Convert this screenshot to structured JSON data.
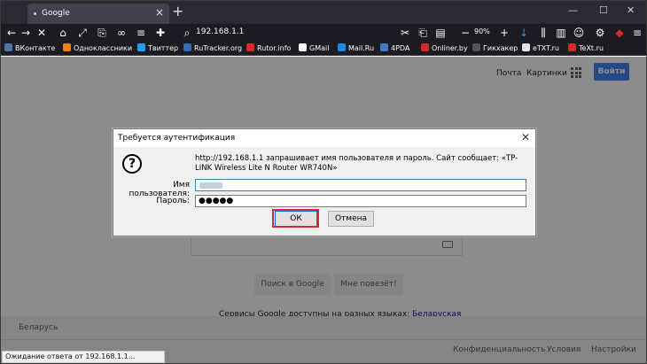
{
  "browser": {
    "tab_title": "Google",
    "url": "192.168.1.1",
    "zoom": "90%"
  },
  "bookmarks": [
    {
      "label": "ВКонтакте",
      "color": "#4a76a8"
    },
    {
      "label": "Одноклассники",
      "color": "#ee8208"
    },
    {
      "label": "Твиттер",
      "color": "#1da1f2"
    },
    {
      "label": "RuTracker.org",
      "color": "#2f6fb5"
    },
    {
      "label": "Rutor.info",
      "color": "#d9272e"
    },
    {
      "label": "GMail",
      "color": "#ffffff"
    },
    {
      "label": "Mail.Ru",
      "color": "#168de2"
    },
    {
      "label": "4PDA",
      "color": "#3b7cc4"
    },
    {
      "label": "Onliner.by",
      "color": "#d9272e"
    },
    {
      "label": "Гикхакер",
      "color": "#2b2b2b"
    },
    {
      "label": "eTXT.ru",
      "color": "#e4e4e4"
    },
    {
      "label": "TeXt.ru",
      "color": "#d9272e"
    }
  ],
  "google": {
    "link_mail": "Почта",
    "link_images": "Картинки",
    "signin_label": "Войти",
    "search_button": "Поиск в Google",
    "lucky_button": "Мне повезёт!",
    "offered_text": "Сервисы Google доступны на разных языках:",
    "offered_lang": "Беларуская",
    "region": "Беларусь",
    "footer_privacy": "Конфиденциальность",
    "footer_terms": "Условия",
    "footer_settings": "Настройки"
  },
  "status_text": "Ожидание ответа от 192.168.1.1...",
  "dialog": {
    "title": "Требуется аутентификация",
    "message": "http://192.168.1.1 запрашивает имя пользователя и пароль. Сайт сообщает: «TP-LINK Wireless Lite N Router WR740N»",
    "username_label": "Имя пользователя:",
    "password_label": "Пароль:",
    "password_value": "●●●●●",
    "ok_label": "ОК",
    "cancel_label": "Отмена"
  },
  "colors": {
    "highlight": "#d9272e",
    "signin_button": "#4285f4"
  }
}
